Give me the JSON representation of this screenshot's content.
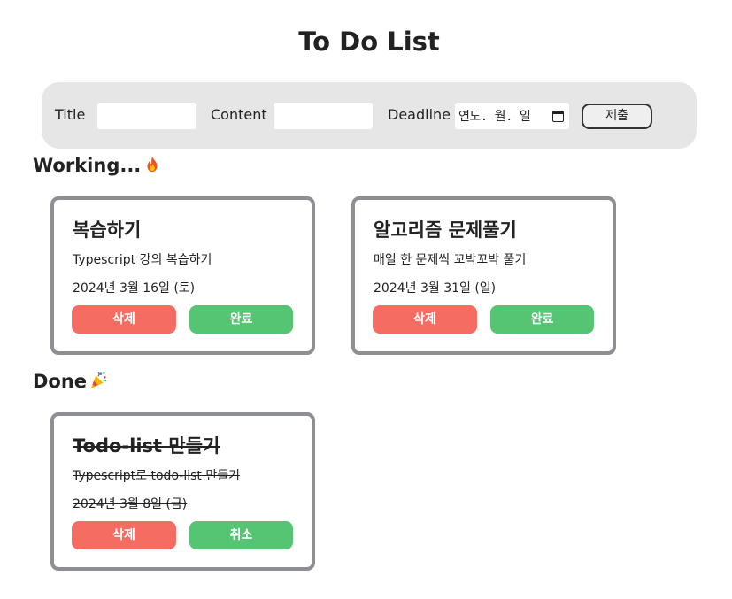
{
  "page": {
    "title": "To Do List"
  },
  "form": {
    "title_label": "Title",
    "content_label": "Content",
    "deadline_label": "Deadline",
    "deadline_placeholder": "연도. 월. 일",
    "submit_label": "제출",
    "title_value": "",
    "content_value": ""
  },
  "sections": {
    "working_label": "Working...",
    "working_icon": "fire-icon",
    "done_label": "Done",
    "done_icon": "party-popper-icon"
  },
  "working": [
    {
      "title": "복습하기",
      "content": "Typescript 강의 복습하기",
      "date": "2024년 3월 16일 (토)",
      "delete_label": "삭제",
      "action_label": "완료"
    },
    {
      "title": "알고리즘 문제풀기",
      "content": "매일 한 문제씩 꼬박꼬박 풀기",
      "date": "2024년 3월 31일 (일)",
      "delete_label": "삭제",
      "action_label": "완료"
    }
  ],
  "done": [
    {
      "title": "Todo-list 만들기",
      "content": "Typescript로 todo-list 만들기",
      "date": "2024년 3월 8일 (금)",
      "delete_label": "삭제",
      "action_label": "취소"
    }
  ],
  "colors": {
    "delete": "#f46c62",
    "complete": "#55c573",
    "card_border": "#8e8e95",
    "form_bg": "#e6e6e6"
  }
}
